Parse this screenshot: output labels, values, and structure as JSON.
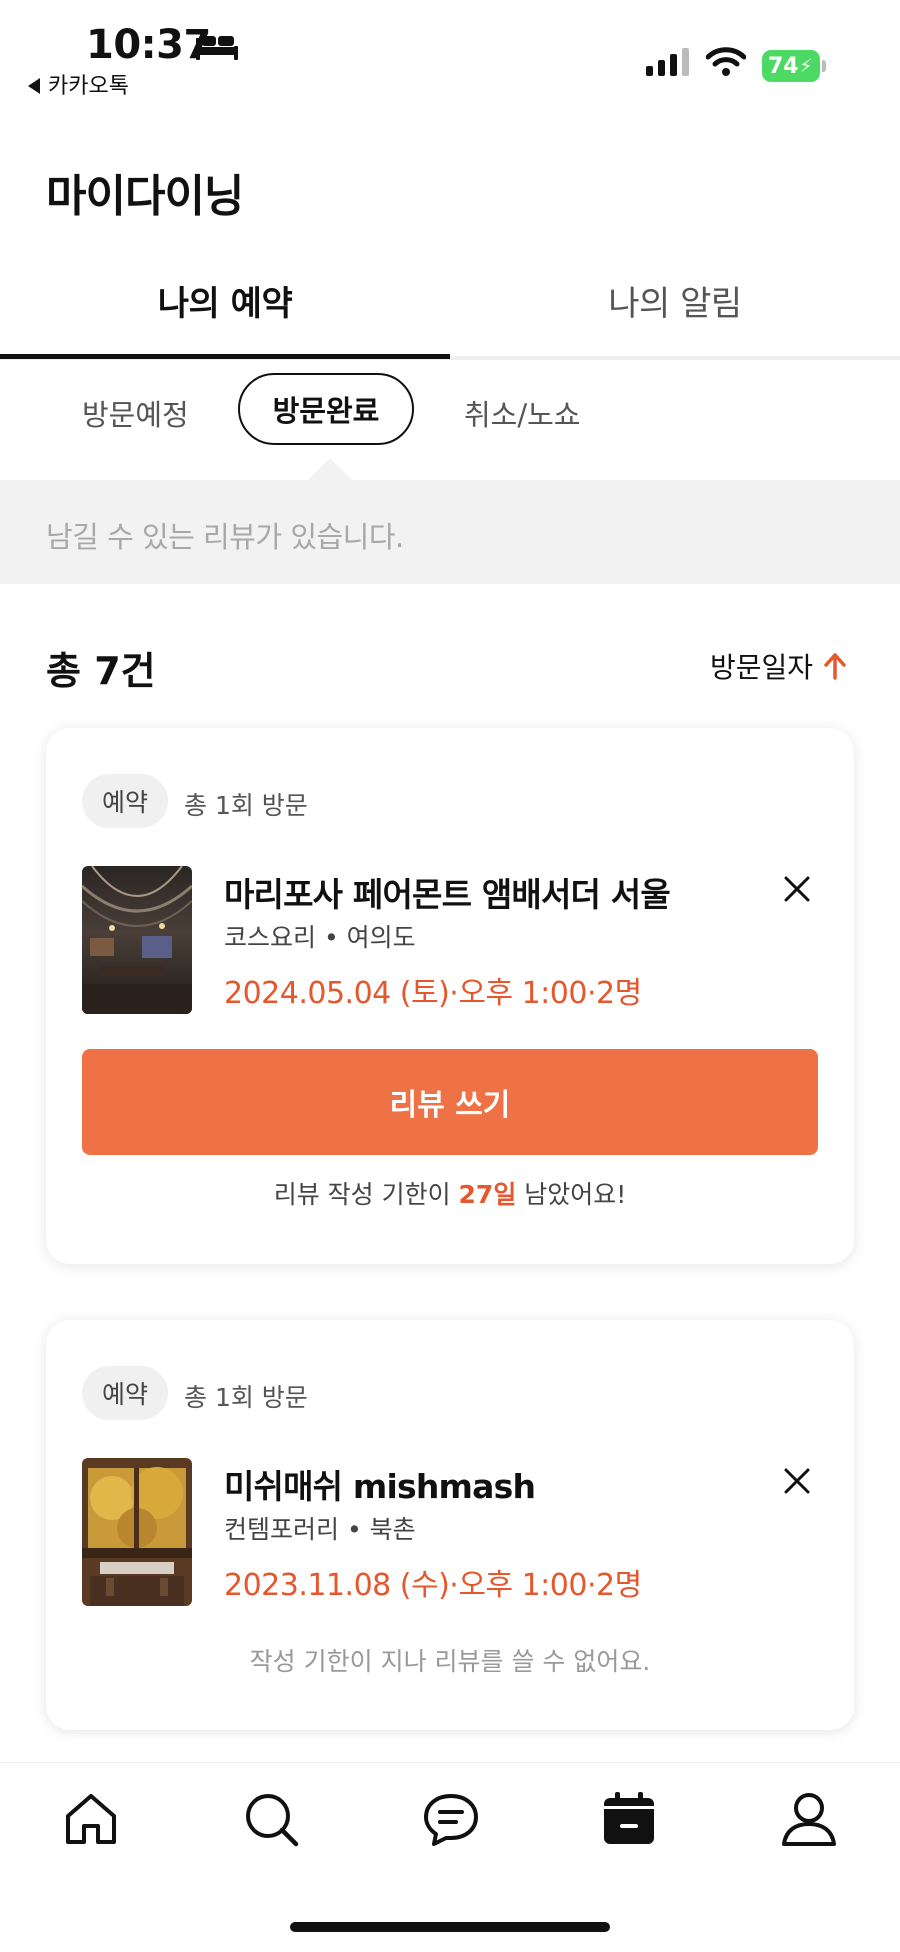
{
  "status_bar": {
    "time": "10:37",
    "back_app": "카카오톡",
    "battery": "74",
    "icons": [
      "bed-icon",
      "signal-icon",
      "wifi-icon",
      "battery-icon"
    ]
  },
  "page": {
    "title": "마이다이닝"
  },
  "tabs": [
    {
      "label": "나의 예약",
      "active": true
    },
    {
      "label": "나의 알림",
      "active": false
    }
  ],
  "subtabs": [
    {
      "label": "방문예정",
      "active": false
    },
    {
      "label": "방문완료",
      "active": true
    },
    {
      "label": "취소/노쇼",
      "active": false
    }
  ],
  "notice": "남길 수 있는 리뷰가 있습니다.",
  "summary": {
    "total": "총 7건",
    "sort_label": "방문일자"
  },
  "reservations": [
    {
      "badge": "예약",
      "visits": "총 1회 방문",
      "name": "마리포사 페어몬트 앰배서더 서울",
      "category": "코스요리",
      "location": "여의도",
      "datetime": "2024.05.04 (토)·오후 1:00·2명",
      "review_button": "리뷰 쓰기",
      "deadline_prefix": "리뷰 작성 기한이 ",
      "deadline_days": "27일",
      "deadline_suffix": " 남았어요!"
    },
    {
      "badge": "예약",
      "visits": "총 1회 방문",
      "name": "미쉬매쉬 mishmash",
      "category": "컨템포러리",
      "location": "북촌",
      "datetime": "2023.11.08 (수)·오후 1:00·2명",
      "expired_note": "작성 기한이 지나 리뷰를 쓸 수 없어요."
    }
  ],
  "bottom_nav": [
    {
      "icon": "home-icon",
      "active": false
    },
    {
      "icon": "search-icon",
      "active": false
    },
    {
      "icon": "chat-icon",
      "active": false
    },
    {
      "icon": "calendar-icon",
      "active": true
    },
    {
      "icon": "profile-icon",
      "active": false
    }
  ],
  "colors": {
    "accent": "#ee7245",
    "accent_text": "#e5572c",
    "notice_bg": "#f2f2f2"
  }
}
